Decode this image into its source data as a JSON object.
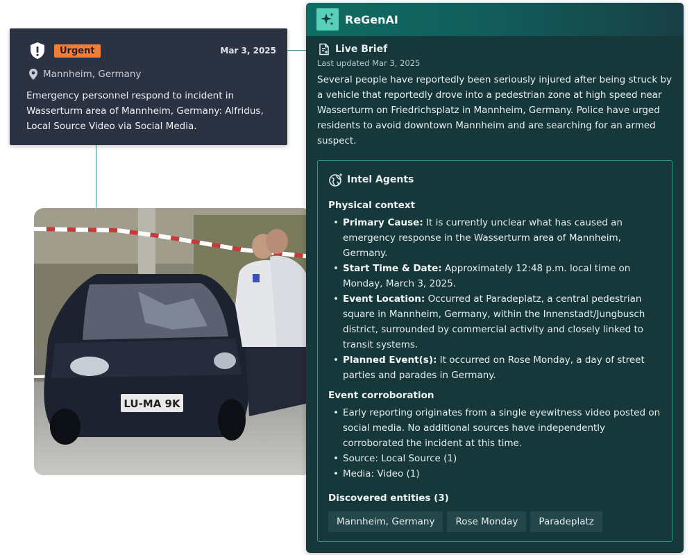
{
  "alert": {
    "badge": "Urgent",
    "date": "Mar 3, 2025",
    "location": "Mannheim, Germany",
    "text": "Emergency personnel respond to incident in Wasserturm area of Mannheim, Germany: Alfridus, Local Source Video via Social Media.",
    "badge_color": "#f07f3c",
    "card_color": "#2b3242"
  },
  "photo": {
    "plate_text": "LU-MA 9K"
  },
  "panel": {
    "app_name": "ReGenAI",
    "brief": {
      "title": "Live Brief",
      "updated": "Last updated Mar 3, 2025",
      "text": "Several people have reportedly been seriously injured after being struck by a vehicle that reportedly drove into a pedestrian zone at high speed near Wasserturm on Friedrichsplatz in Mannheim, Germany. Police have urged residents to avoid downtown Mannheim and are searching for an armed suspect."
    },
    "agents": {
      "title": "Intel Agents",
      "physical_title": "Physical context",
      "physical_items": [
        {
          "label": "Primary Cause:",
          "text": " It is currently unclear what has caused an emergency response in the Wasserturm area of Mannheim, Germany."
        },
        {
          "label": "Start Time & Date:",
          "text": " Approximately 12:48 p.m. local time on Monday, March 3, 2025."
        },
        {
          "label": "Event Location:",
          "text": " Occurred at Paradeplatz, a central pedestrian square in Mannheim, Germany, within the Innenstadt/Jungbusch district, surrounded by commercial activity and closely linked to transit systems."
        },
        {
          "label": "Planned Event(s):",
          "text": " It occurred on Rose Monday, a day of street parties and parades in Germany."
        }
      ],
      "corroboration_title": "Event corroboration",
      "corroboration_items": [
        "Early reporting originates from a single eyewitness video posted on social media. No additional sources have independently corroborated the incident at this time.",
        "Source: Local Source (1)",
        "Media: Video (1)"
      ],
      "entities_title": "Discovered entities (3)",
      "entities": [
        "Mannheim, Germany",
        "Rose Monday",
        "Paradeplatz"
      ]
    },
    "colors": {
      "panel_bg": "#16383b",
      "accent": "#2a9b8a",
      "header_start": "#0f6d62"
    }
  }
}
